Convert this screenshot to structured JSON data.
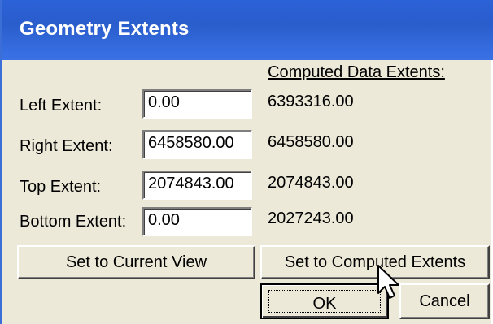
{
  "window": {
    "title": "Geometry Extents"
  },
  "computed": {
    "header": "Computed Data Extents:",
    "left": "6393316.00",
    "right": "6458580.00",
    "top": "2074843.00",
    "bottom": "2027243.00"
  },
  "fields": {
    "left": {
      "label": "Left Extent:",
      "value": "0.00"
    },
    "right": {
      "label": "Right Extent:",
      "value": "6458580.00"
    },
    "top": {
      "label": "Top Extent:",
      "value": "2074843.00"
    },
    "bottom": {
      "label": "Bottom Extent:",
      "value": "0.00"
    }
  },
  "buttons": {
    "set_current_view": "Set to Current View",
    "set_computed": "Set to Computed Extents",
    "ok": "OK",
    "cancel": "Cancel"
  },
  "icons": {
    "cursor": "arrow-pointer-icon"
  },
  "colors": {
    "titlebar": "#2a5dcc",
    "dialog_bg": "#ece9d8",
    "title_text": "#ffffff"
  }
}
